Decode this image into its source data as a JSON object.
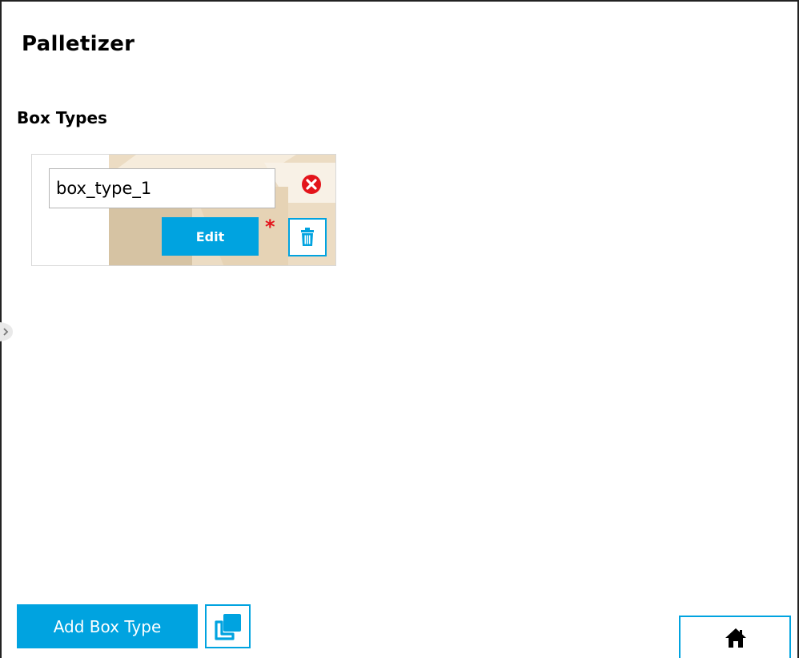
{
  "page": {
    "title": "Palletizer"
  },
  "box_types": {
    "section_title": "Box Types",
    "items": [
      {
        "name": "box_type_1",
        "edit_label": "Edit",
        "required_mark": "*"
      }
    ]
  },
  "actions": {
    "add_label": "Add Box Type"
  },
  "icons": {
    "remove": "remove-circle-icon",
    "delete": "trash-icon",
    "copy": "copy-icon",
    "home": "home-icon",
    "collapse": "collapse-handle-icon"
  },
  "colors": {
    "accent": "#00a3e0",
    "remove_red": "#e3141b",
    "box_light": "#ecdcc3",
    "box_dark": "#d6c3a3"
  }
}
